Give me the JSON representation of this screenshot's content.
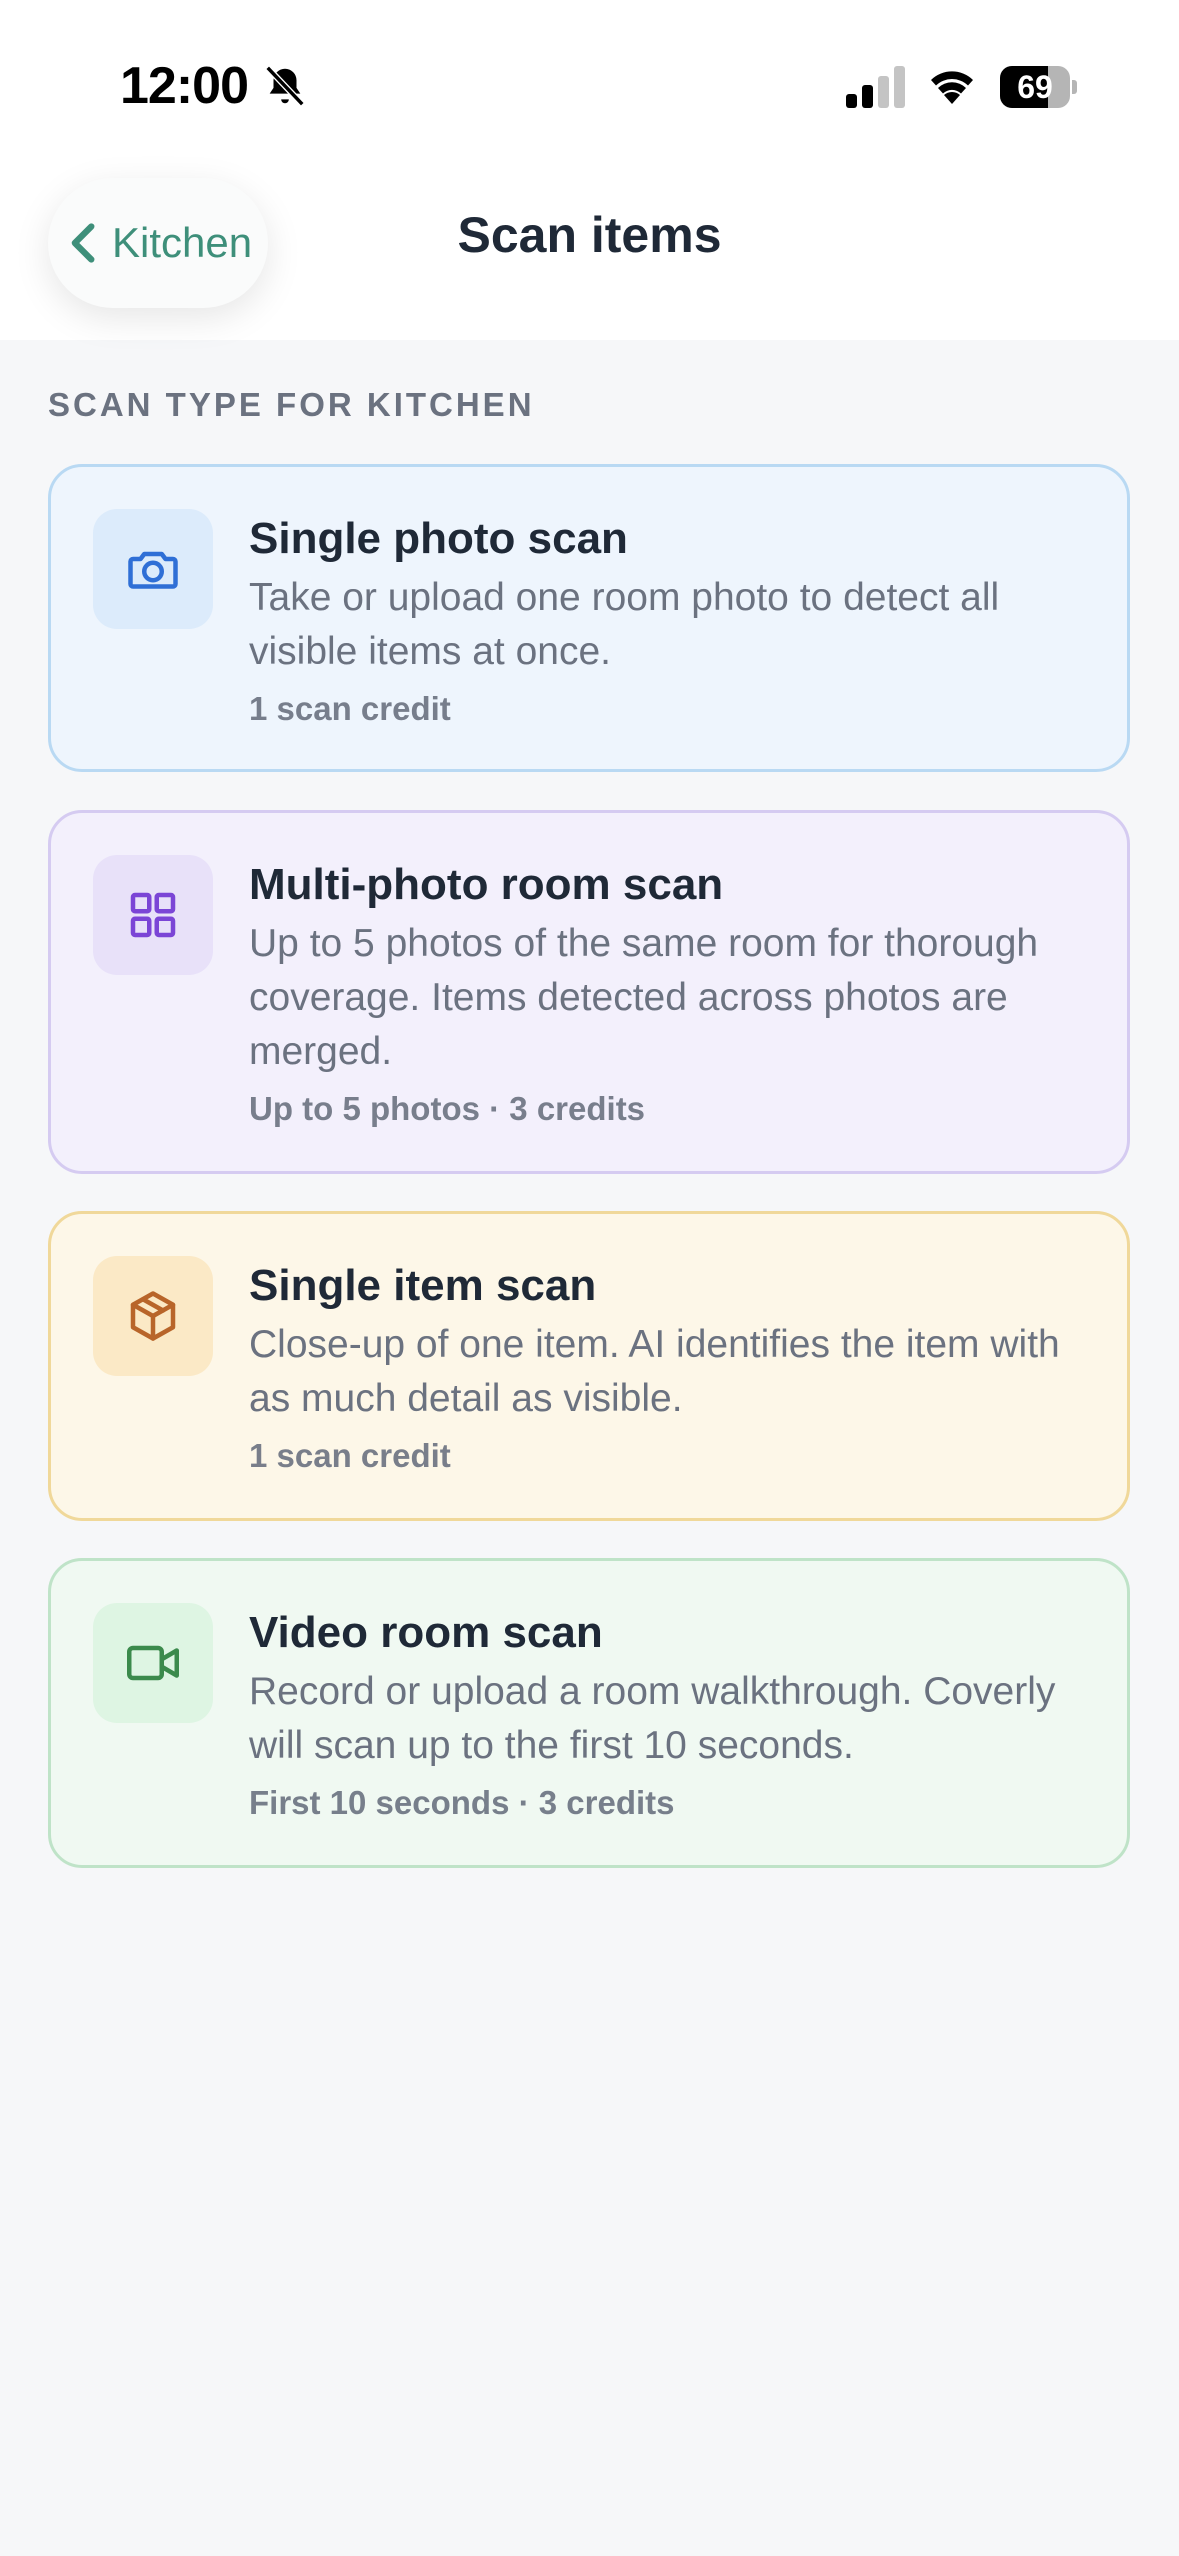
{
  "status_bar": {
    "time": "12:00",
    "battery_percent": "69",
    "battery_level": 0.69
  },
  "nav": {
    "back_label": "Kitchen",
    "title": "Scan items"
  },
  "section": {
    "heading": "SCAN TYPE FOR KITCHEN"
  },
  "cards": [
    {
      "title": "Single photo scan",
      "description": "Take or upload one room photo to detect all visible items at once.",
      "meta": "1 scan credit",
      "icon": "camera-icon",
      "bg": "#eef5fd",
      "border": "#b9d9f3",
      "icon_bg": "#dcebfb",
      "icon_color": "#2f6fd6"
    },
    {
      "title": "Multi-photo room scan",
      "description": "Up to 5 photos of the same room for thorough coverage. Items detected across photos are merged.",
      "meta": "Up to 5 photos · 3 credits",
      "icon": "grid-icon",
      "bg": "#f3f0fc",
      "border": "#d5cbf1",
      "icon_bg": "#e8e1f9",
      "icon_color": "#7b45d6"
    },
    {
      "title": "Single item scan",
      "description": "Close-up of one item. AI identifies the item with as much detail as visible.",
      "meta": "1 scan credit",
      "icon": "box-icon",
      "bg": "#fdf7e8",
      "border": "#f0d89a",
      "icon_bg": "#fbe9c6",
      "icon_color": "#b8652a"
    },
    {
      "title": "Video room scan",
      "description": "Record or upload a room walkthrough. Coverly will scan up to the first 10 seconds.",
      "meta": "First 10 seconds · 3 credits",
      "icon": "video-camera-icon",
      "bg": "#f0f9f2",
      "border": "#bfe3c8",
      "icon_bg": "#def5e3",
      "icon_color": "#3b8a4c"
    }
  ]
}
